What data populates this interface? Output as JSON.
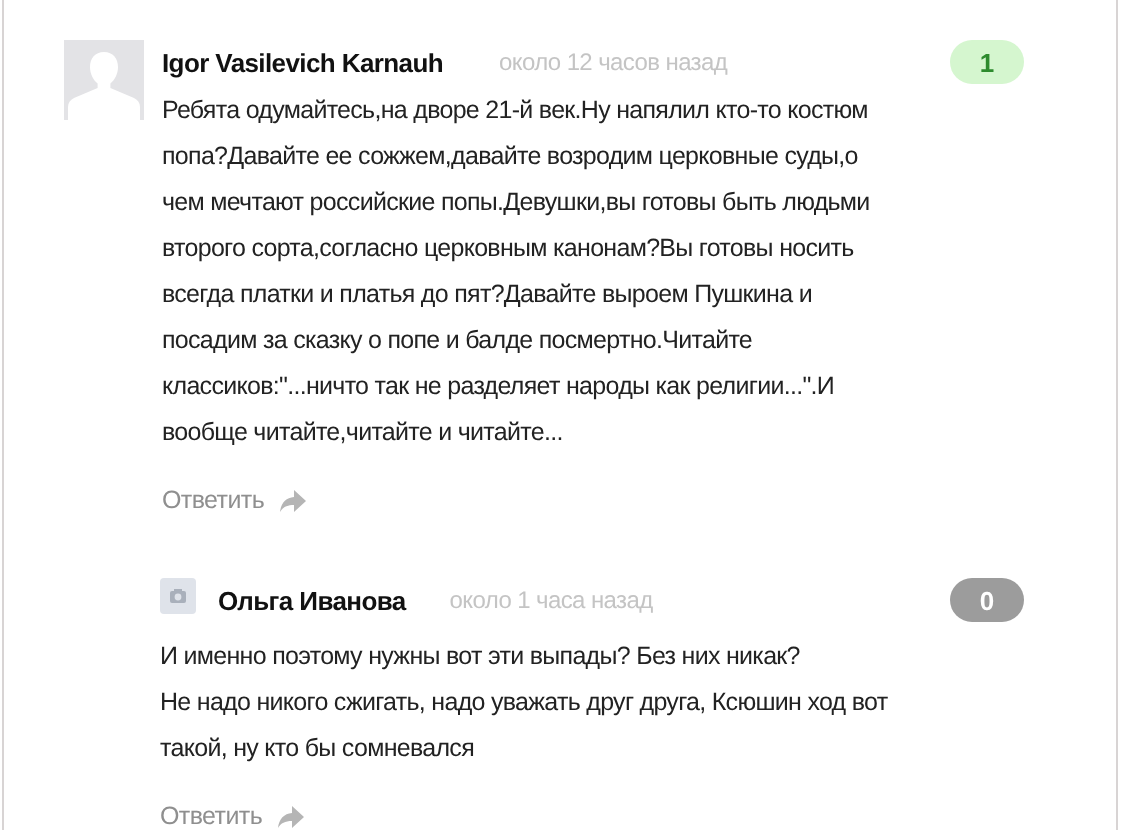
{
  "comments": [
    {
      "avatar": {
        "kind": "silhouette"
      },
      "author": "Igor Vasilevich Karnauh",
      "time": "около 12 часов назад",
      "vote": {
        "kind": "positive",
        "count": "1"
      },
      "body_lines": [
        "Ребята одумайтесь,на дворе 21-й век.Ну напялил кто-то костюм",
        "попа?Давайте ее сожжем,давайте возродим церковные суды,о",
        "чем мечтают российские попы.Девушки,вы готовы быть людьми",
        "второго сорта,согласно церковным канонам?Вы готовы носить",
        "всегда платки и платья до пят?Давайте выроем Пушкина и",
        "посадим за сказку о попе и балде посмертно.Читайте",
        "классиков:\"...ничто так не разделяет народы как религии...\".И",
        "вообще читайте,читайте и читайте..."
      ],
      "reply_label": "Ответить",
      "replies": [
        {
          "avatar": {
            "kind": "camera"
          },
          "author": "Ольга Иванова",
          "time": "около 1 часа назад",
          "vote": {
            "kind": "neutral",
            "count": "0"
          },
          "body_lines": [
            "И именно поэтому нужны вот эти выпады? Без них никак?",
            "Не надо никого сжигать, надо уважать друг друга, Ксюшин ход вот",
            "такой, ну кто бы сомневался"
          ],
          "reply_label": "Ответить"
        }
      ]
    }
  ]
}
